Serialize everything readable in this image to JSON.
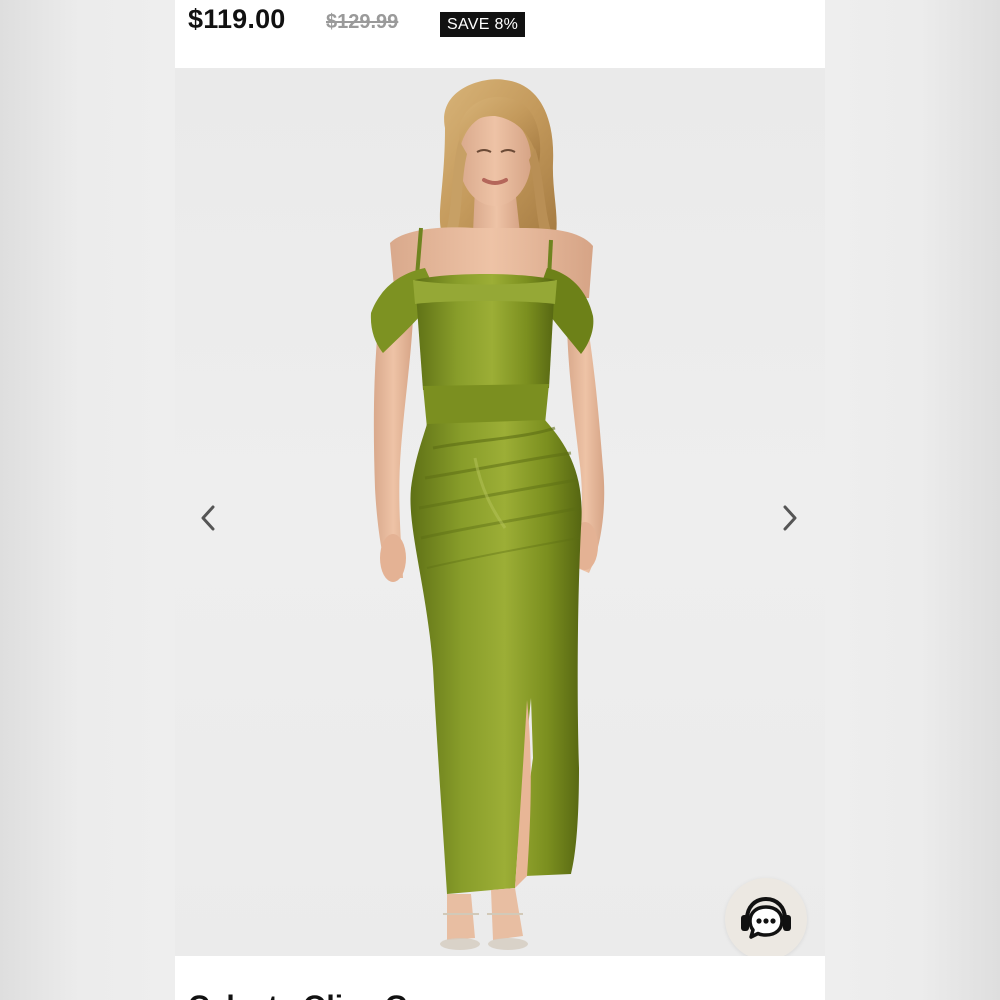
{
  "product": {
    "price": "$119.00",
    "original_price": "$129.99",
    "save_badge": "SAVE 8%",
    "title": "Celesta Olive Gown"
  },
  "gallery": {
    "prev_icon": "chevron-left-icon",
    "next_icon": "chevron-right-icon",
    "image_subject": "model wearing olive satin off-shoulder maxi gown"
  },
  "support": {
    "icon": "headset-chat-icon"
  },
  "colors": {
    "dress": "#7a8f22",
    "dress_shadow": "#5a6a14",
    "dress_highlight": "#a3b43c",
    "badge_bg": "#111111",
    "chat_bg": "#ece8e2"
  }
}
